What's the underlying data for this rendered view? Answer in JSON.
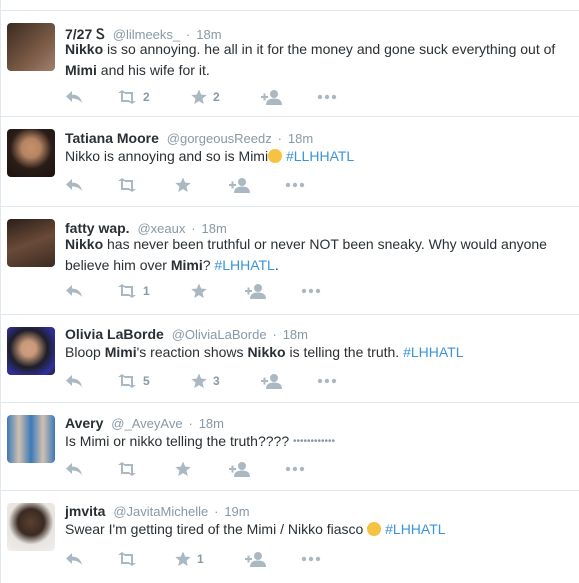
{
  "tweets": [
    {
      "name": "7/27 Ꮪ",
      "handle": "@lilmeeks_",
      "sep": "·",
      "time": "18m",
      "segments": [
        {
          "t": "Nikko",
          "b": true
        },
        {
          "t": " is so annoying. he all in it for the money and gone suck everything out of "
        },
        {
          "t": "Mimi",
          "b": true
        },
        {
          "t": " and his wife for it."
        }
      ],
      "retweets": "2",
      "favorites": "2",
      "avatar_colors": [
        "#3a2a20",
        "#7a5a45"
      ]
    },
    {
      "name": "Tatiana Moore",
      "handle": "@gorgeousReedz",
      "sep": "·",
      "time": "18m",
      "segments": [
        {
          "t": "Nikko is annoying and so is Mimi"
        },
        {
          "emoji": "weary-face"
        },
        {
          "t": " "
        },
        {
          "t": "#LLHHATL",
          "h": true
        }
      ],
      "retweets": "",
      "favorites": "",
      "avatar_colors": [
        "#2b1d17",
        "#b58463"
      ]
    },
    {
      "name": "fatty wap.",
      "handle": "@xeaux",
      "sep": "·",
      "time": "18m",
      "segments": [
        {
          "t": "Nikko",
          "b": true
        },
        {
          "t": " has never been truthful or never NOT been sneaky. Why would anyone believe him over "
        },
        {
          "t": "Mimi",
          "b": true
        },
        {
          "t": "? "
        },
        {
          "t": "#LHHATL",
          "h": true
        },
        {
          "t": "."
        }
      ],
      "retweets": "1",
      "favorites": "",
      "avatar_colors": [
        "#3b2b22",
        "#8a6a50"
      ]
    },
    {
      "name": "Olivia LaBorde",
      "handle": "@OliviaLaBorde",
      "sep": "·",
      "time": "18m",
      "segments": [
        {
          "t": "Bloop "
        },
        {
          "t": "Mimi",
          "b": true
        },
        {
          "t": "'s reaction shows "
        },
        {
          "t": "Nikko",
          "b": true
        },
        {
          "t": " is telling the truth. "
        },
        {
          "t": "#LHHATL",
          "h": true
        }
      ],
      "retweets": "5",
      "favorites": "3",
      "avatar_colors": [
        "#1e1e28",
        "#c89a7a"
      ]
    },
    {
      "name": "Avery",
      "handle": "@_AveyAve",
      "sep": "·",
      "time": "18m",
      "segments": [
        {
          "t": "Is Mimi or nikko telling the truth???? "
        },
        {
          "t": "••••••••••••",
          "dots": true
        }
      ],
      "retweets": "",
      "favorites": "",
      "avatar_colors": [
        "#3c7ab8",
        "#d0c0b0"
      ]
    },
    {
      "name": "jmvita",
      "handle": "@JavitaMichelle",
      "sep": "·",
      "time": "19m",
      "segments": [
        {
          "t": "Swear I'm getting tired of the Mimi / Nikko fiasco "
        },
        {
          "emoji": "unamused-face"
        },
        {
          "t": " "
        },
        {
          "t": "#LHHATL",
          "h": true
        }
      ],
      "retweets": "",
      "favorites": "1",
      "avatar_colors": [
        "#e8e4e0",
        "#3a2a22"
      ]
    }
  ],
  "colors": {
    "name": "#292f33",
    "meta": "#8899a6",
    "hashtag": "#3b94d9",
    "action": "#aab8c2",
    "border": "#e1e8ed"
  },
  "icons": [
    "reply-icon",
    "retweet-icon",
    "favorite-star-icon",
    "follow-icon",
    "more-icon"
  ]
}
